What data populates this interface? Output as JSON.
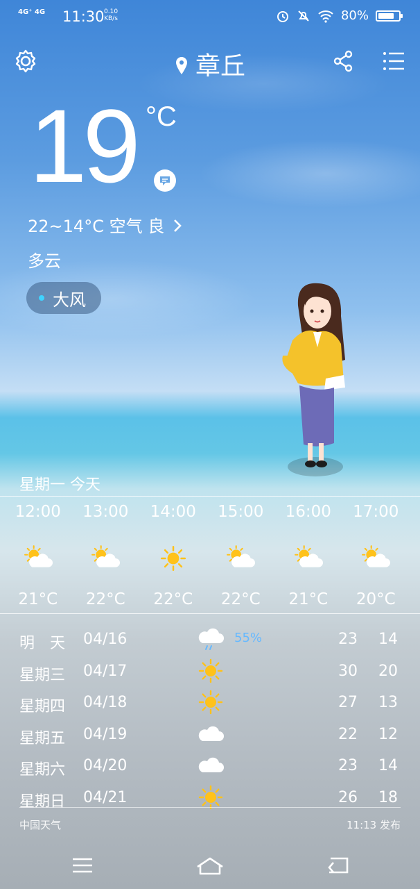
{
  "status_bar": {
    "network": "4G⁺ 4G",
    "time": "11:30",
    "speed_value": "0.10",
    "speed_unit": "KB/s",
    "battery": "80%",
    "battery_level": 0.8
  },
  "header": {
    "city": "章丘"
  },
  "current": {
    "temp": "19",
    "unit": "°C",
    "range_air": "22~14°C  空气 良",
    "condition": "多云",
    "alert": "大风"
  },
  "hourly": {
    "day_label": "星期一  今天",
    "items": [
      {
        "time": "12:00",
        "icon": "partly-cloudy",
        "temp": "21°C"
      },
      {
        "time": "13:00",
        "icon": "partly-cloudy",
        "temp": "22°C"
      },
      {
        "time": "14:00",
        "icon": "sunny",
        "temp": "22°C"
      },
      {
        "time": "15:00",
        "icon": "partly-cloudy",
        "temp": "22°C"
      },
      {
        "time": "16:00",
        "icon": "partly-cloudy",
        "temp": "21°C"
      },
      {
        "time": "17:00",
        "icon": "partly-cloudy",
        "temp": "20°C"
      }
    ]
  },
  "daily": [
    {
      "day": "明　天",
      "date": "04/16",
      "icon": "rain-cloud",
      "precip": "55%",
      "high": "23",
      "low": "14"
    },
    {
      "day": "星期三",
      "date": "04/17",
      "icon": "sunny",
      "precip": "",
      "high": "30",
      "low": "20"
    },
    {
      "day": "星期四",
      "date": "04/18",
      "icon": "sunny",
      "precip": "",
      "high": "27",
      "low": "13"
    },
    {
      "day": "星期五",
      "date": "04/19",
      "icon": "cloudy",
      "precip": "",
      "high": "22",
      "low": "12"
    },
    {
      "day": "星期六",
      "date": "04/20",
      "icon": "cloudy",
      "precip": "",
      "high": "23",
      "low": "14"
    },
    {
      "day": "星期日",
      "date": "04/21",
      "icon": "sunny",
      "precip": "",
      "high": "26",
      "low": "18"
    }
  ],
  "footer": {
    "source": "中国天气",
    "published": "11:13 发布"
  },
  "colors": {
    "sun": "#ffc21a",
    "precip": "#66b9ff",
    "alert_dot": "#3fd3ff"
  }
}
